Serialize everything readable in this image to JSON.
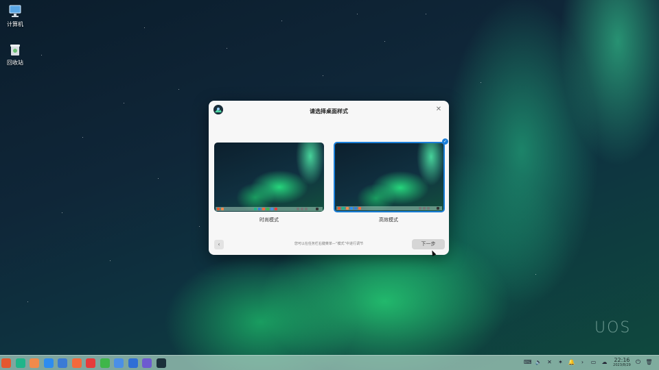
{
  "desktop": {
    "icons": [
      {
        "label": "计算机",
        "icon": "computer-icon"
      },
      {
        "label": "回收站",
        "icon": "trash-icon"
      }
    ],
    "watermark": "UOS"
  },
  "dialog": {
    "title": "请选择桌面样式",
    "options": [
      {
        "label": "时尚模式",
        "selected": false
      },
      {
        "label": "高效模式",
        "selected": true
      }
    ],
    "hint": "您可以在任务栏右键菜单—“模式”中进行调节",
    "next_label": "下一步",
    "back_icon": "chevron-left-icon",
    "close_icon": "close-icon",
    "accent": "#1a7fd9"
  },
  "taskbar": {
    "apps": [
      {
        "icon": "launcher-icon",
        "color": "#e4572e"
      },
      {
        "icon": "multitask-view-icon",
        "color": "#1fb58a"
      },
      {
        "icon": "file-manager-icon",
        "color": "#f08a4b"
      },
      {
        "icon": "app-store-icon",
        "color": "#2d8cf0"
      },
      {
        "icon": "browser-icon",
        "color": "#3a7bd5"
      },
      {
        "icon": "music-icon",
        "color": "#f5693b"
      },
      {
        "icon": "video-icon",
        "color": "#e63b3b"
      },
      {
        "icon": "calendar-icon",
        "color": "#3fb64a"
      },
      {
        "icon": "document-viewer-icon",
        "color": "#4a8fe7"
      },
      {
        "icon": "text-editor-icon",
        "color": "#2f6fd6"
      },
      {
        "icon": "settings-icon",
        "color": "#6d5bd0"
      },
      {
        "icon": "welcome-icon",
        "color": "#1b2f3a"
      }
    ],
    "tray": [
      {
        "icon": "keyboard-icon",
        "glyph": "⌨"
      },
      {
        "icon": "volume-icon",
        "glyph": "🔈"
      },
      {
        "icon": "network-icon",
        "glyph": "✕"
      },
      {
        "icon": "bluetooth-icon",
        "glyph": "✶"
      },
      {
        "icon": "notification-icon",
        "glyph": "🔔"
      },
      {
        "icon": "expand-tray-icon",
        "glyph": "›"
      },
      {
        "icon": "screen-icon",
        "glyph": "▭"
      },
      {
        "icon": "cloud-icon",
        "glyph": "☁"
      }
    ],
    "clock_time": "22:16",
    "clock_date": "2023/8/29",
    "power_icon": "power-icon",
    "trash_icon": "trash-icon"
  }
}
